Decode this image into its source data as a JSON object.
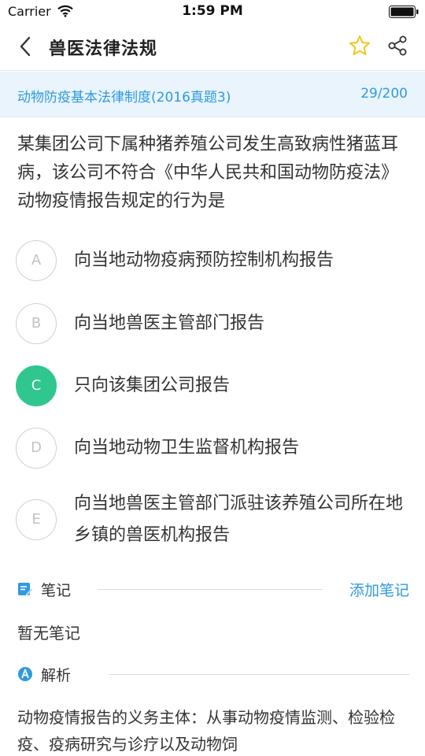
{
  "status": {
    "carrier": "Carrier",
    "time": "1:59 PM"
  },
  "nav": {
    "title": "兽医法律法规"
  },
  "topic": {
    "label": "动物防疫基本法律制度(2016真题3)",
    "progress": "29/200"
  },
  "question": {
    "text": "某集团公司下属种猪养殖公司发生高致病性猪蓝耳病，该公司不符合《中华人民共和国动物防疫法》动物疫情报告规定的行为是"
  },
  "options": [
    {
      "letter": "A",
      "text": "向当地动物疫病预防控制机构报告"
    },
    {
      "letter": "B",
      "text": "向当地兽医主管部门报告"
    },
    {
      "letter": "C",
      "text": "只向该集团公司报告"
    },
    {
      "letter": "D",
      "text": "向当地动物卫生监督机构报告"
    },
    {
      "letter": "E",
      "text": "向当地兽医主管部门派驻该养殖公司所在地乡镇的兽医机构报告"
    }
  ],
  "notes": {
    "title": "笔记",
    "add_label": "添加笔记",
    "empty_text": "暂无笔记"
  },
  "analysis": {
    "title": "解析",
    "text": "动物疫情报告的义务主体：从事动物疫情监测、检验检疫、疫病研究与诊疗以及动物饲"
  },
  "colors": {
    "accent": "#2e9ae0",
    "selected": "#2fc78f",
    "star": "#f5c518",
    "topic_bg": "#eaf4fd"
  },
  "icons": {
    "back": "chevron-left-icon",
    "favorite": "star-icon",
    "share": "share-icon",
    "notes": "note-edit-icon",
    "analysis": "analysis-a-icon"
  }
}
